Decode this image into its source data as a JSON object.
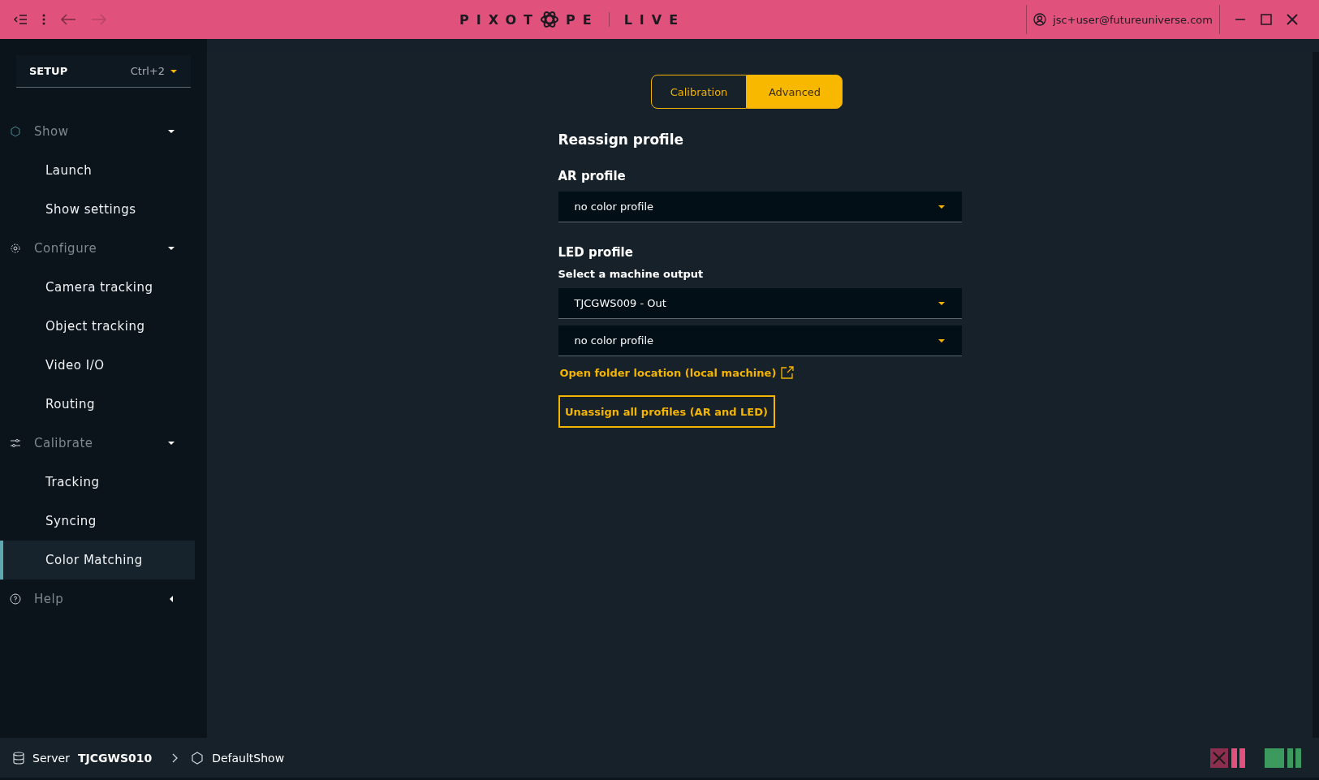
{
  "title_bar": {
    "logo": {
      "left": "PIXOT",
      "right": "PE",
      "product": "LIVE"
    },
    "user": "jsc+user@futureuniverse.com"
  },
  "sidebar": {
    "mode": {
      "label": "SETUP",
      "shortcut": "Ctrl+2"
    },
    "sections": [
      {
        "label": "Show",
        "kind": "show",
        "expanded": true,
        "children": [
          {
            "label": "Launch",
            "selected": false
          },
          {
            "label": "Show settings",
            "selected": false
          }
        ]
      },
      {
        "label": "Configure",
        "kind": "configure",
        "expanded": true,
        "children": [
          {
            "label": "Camera tracking",
            "selected": false
          },
          {
            "label": "Object tracking",
            "selected": false
          },
          {
            "label": "Video I/O",
            "selected": false
          },
          {
            "label": "Routing",
            "selected": false
          }
        ]
      },
      {
        "label": "Calibrate",
        "kind": "calibrate",
        "expanded": true,
        "children": [
          {
            "label": "Tracking",
            "selected": false
          },
          {
            "label": "Syncing",
            "selected": false
          },
          {
            "label": "Color Matching",
            "selected": true
          }
        ]
      },
      {
        "label": "Help",
        "kind": "help",
        "expanded": false
      }
    ]
  },
  "tabs": [
    {
      "label": "Calibration",
      "selected": false
    },
    {
      "label": "Advanced",
      "selected": true
    }
  ],
  "content": {
    "title": "Reassign profile",
    "ar_profile": {
      "label": "AR profile",
      "value": "no color profile"
    },
    "led_profile": {
      "label": "LED profile",
      "sublabel": "Select a machine output",
      "output": "TJCGWS009 - Out",
      "value": "no color profile"
    },
    "folder_link": "Open folder location (local machine)",
    "unassign_button": "Unassign all profiles (AR and LED)"
  },
  "status_bar": {
    "server_label": "Server",
    "server_name": "TJCGWS010",
    "show": "DefaultShow"
  }
}
